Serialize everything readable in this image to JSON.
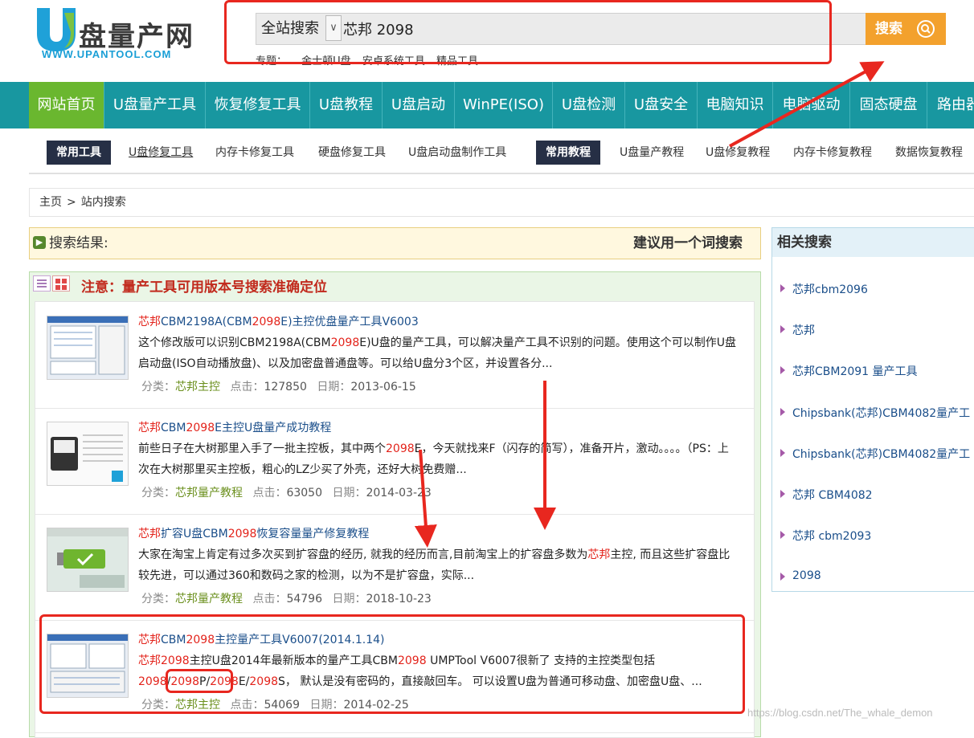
{
  "logo": {
    "mark": "U",
    "cn": "盘量产网",
    "en": "WWW.UPANTOOL.COM"
  },
  "search": {
    "scope": "全站搜索",
    "query": "芯邦 2098",
    "button": "搜索",
    "topics_label": "专题：",
    "topics": [
      "金士顿U盘",
      "安卓系统工具",
      "精品工具"
    ]
  },
  "nav": [
    "网站首页",
    "U盘量产工具",
    "恢复修复工具",
    "U盘教程",
    "U盘启动",
    "WinPE(ISO)",
    "U盘检测",
    "U盘安全",
    "电脑知识",
    "电脑驱动",
    "固态硬盘",
    "路由器"
  ],
  "subnav": {
    "tools_tag": "常用工具",
    "tools": [
      "U盘修复工具",
      "内存卡修复工具",
      "硬盘修复工具",
      "U盘启动盘制作工具"
    ],
    "tutorials_tag": "常用教程",
    "tutorials": [
      "U盘量产教程",
      "U盘修复教程",
      "内存卡修复教程",
      "数据恢复教程"
    ]
  },
  "breadcrumb": {
    "home": "主页",
    "sep": ">",
    "current": "站内搜索"
  },
  "results_header": {
    "title": "搜索结果:",
    "tip": "建议用一个词搜索"
  },
  "notice": "注意：量产工具可用版本号搜索准确定位",
  "meta_labels": {
    "category": "分类：",
    "clicks": "点击：",
    "date": "日期："
  },
  "results": [
    {
      "title": [
        "芯邦",
        "CBM2198A(CBM",
        "2098",
        "E)主控优盘量产工具V6003"
      ],
      "desc": [
        "这个修改版可以识别CBM2198A(CBM",
        "2098",
        "E)U盘的量产工具，可以解决量产工具不识别的问题。使用这个可以制作U盘启动盘(ISO自动播放盘)、以及加密盘普通盘等。可以给U盘分3个区，并设置各分..."
      ],
      "category": "芯邦主控",
      "clicks": "127850",
      "date": "2013-06-15"
    },
    {
      "title": [
        "芯邦",
        "CBM",
        "2098",
        "E主控U盘量产成功教程"
      ],
      "desc": [
        "前些日子在大树那里入手了一批主控板，其中两个",
        "2098",
        "E，今天就找来F（闪存的简写），准备开片，激动。。。。（PS：上次在大树那里买主控板，粗心的LZ少买了外壳，还好大树免费赠..."
      ],
      "category": "芯邦量产教程",
      "clicks": "63050",
      "date": "2014-03-23"
    },
    {
      "title": [
        "芯邦",
        "扩容U盘CBM",
        "2098",
        "恢复容量量产修复教程"
      ],
      "desc": [
        "大家在淘宝上肯定有过多次买到扩容盘的经历, 就我的经历而言,目前淘宝上的扩容盘多数为",
        "芯邦",
        "主控, 而且这些扩容盘比较先进，可以通过360和数码之家的检测，以为不是扩容盘，实际..."
      ],
      "category": "芯邦量产教程",
      "clicks": "54796",
      "date": "2018-10-23"
    },
    {
      "title": [
        "芯邦",
        "CBM",
        "2098",
        "主控量产工具V6007(2014.1.14)"
      ],
      "desc": [
        "",
        "芯邦2098",
        "主控U盘2014年最新版本的量产工具CBM",
        "2098",
        " UMPTool V6007很新了 支持的主控类型包括",
        "2098",
        "/",
        "2098",
        "P/",
        "2098",
        "E/",
        "2098",
        "S， 默认是没有密码的，直接敲回车。 可以设置U盘为普通可移动盘、加密盘U盘、..."
      ],
      "category": "芯邦主控",
      "clicks": "54069",
      "date": "2014-02-25"
    }
  ],
  "sidebar": {
    "title": "相关搜索",
    "items": [
      "芯邦cbm2096",
      "芯邦",
      "芯邦CBM2091 量产工具",
      "Chipsbank(芯邦)CBM4082量产工",
      "Chipsbank(芯邦)CBM4082量产工",
      "芯邦 CBM4082",
      "芯邦 cbm2093",
      "2098"
    ]
  },
  "watermark": "https://blog.csdn.net/The_whale_demon",
  "colors": {
    "nav": "#1897a0",
    "nav_active": "#6ab72f",
    "search_button": "#f3a12d",
    "highlight": "#e3231b",
    "annotation": "#e8271f"
  }
}
